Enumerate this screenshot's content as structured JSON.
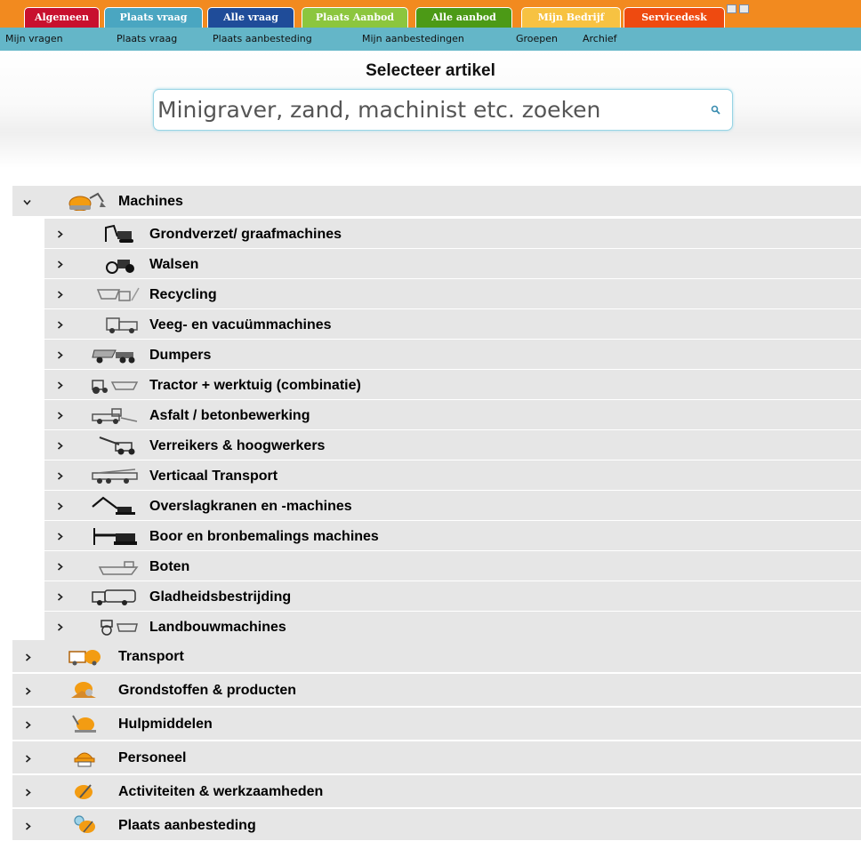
{
  "top_tabs": [
    {
      "label": "Algemeen",
      "color": "#c8102e"
    },
    {
      "label": "Plaats vraag",
      "color": "#4aa6c1"
    },
    {
      "label": "Alle vraag",
      "color": "#1f4c99"
    },
    {
      "label": "Plaats Aanbod",
      "color": "#8cc63e"
    },
    {
      "label": "Alle aanbod",
      "color": "#4c9a16"
    },
    {
      "label": "Mijn Bedrijf",
      "color": "#f7c242"
    },
    {
      "label": "Servicedesk",
      "color": "#ee4a10"
    }
  ],
  "sub_nav": [
    "Mijn vragen",
    "Plaats vraag",
    "Plaats aanbesteding",
    "Mijn aanbestedingen",
    "Groepen",
    "Archief"
  ],
  "page": {
    "title": "Selecteer artikel"
  },
  "search": {
    "placeholder": "Minigraver, zand, machinist etc. zoeken",
    "value": ""
  },
  "tree": {
    "machines": {
      "label": "Machines",
      "expanded": true,
      "children": [
        "Grondverzet/ graafmachines",
        "Walsen",
        "Recycling",
        "Veeg- en vacuümmachines",
        "Dumpers",
        "Tractor + werktuig (combinatie)",
        "Asfalt / betonbewerking",
        "Verreikers & hoogwerkers",
        "Verticaal Transport",
        "Overslagkranen en -machines",
        "Boor en bronbemalings machines",
        "Boten",
        "Gladheidsbestrijding",
        "Landbouwmachines"
      ]
    },
    "others": [
      "Transport",
      "Grondstoffen & producten",
      "Hulpmiddelen",
      "Personeel",
      "Activiteiten & werkzaamheden",
      "Plaats aanbesteding"
    ]
  },
  "colors": {
    "accent_orange": "#f28a1f",
    "subnav_teal": "#64b6c8",
    "row_bg": "#e6e6e6"
  }
}
